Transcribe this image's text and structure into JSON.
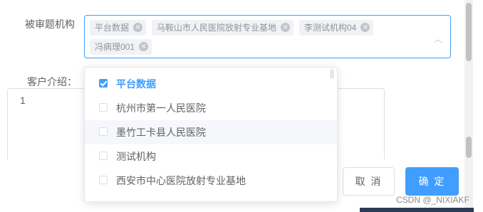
{
  "form": {
    "org_label": "被审题机构",
    "client_label": "客户介绍：",
    "selected_tags": [
      "平台数据",
      "马鞍山市人民医院放射专业基地",
      "李测试机构04",
      "冯病理001"
    ],
    "textarea_value": "1"
  },
  "dropdown": {
    "options": [
      {
        "label": "平台数据",
        "checked": true
      },
      {
        "label": "杭州市第一人民医院",
        "checked": false
      },
      {
        "label": "墨竹工卡县人民医院",
        "checked": false
      },
      {
        "label": "测试机构",
        "checked": false
      },
      {
        "label": "西安市中心医院放射专业基地",
        "checked": false
      }
    ]
  },
  "footer": {
    "cancel_label": "取 消",
    "confirm_label": "确 定",
    "watermark": "CSDN @_NIXIAKF"
  },
  "colors": {
    "primary": "#409eff"
  }
}
